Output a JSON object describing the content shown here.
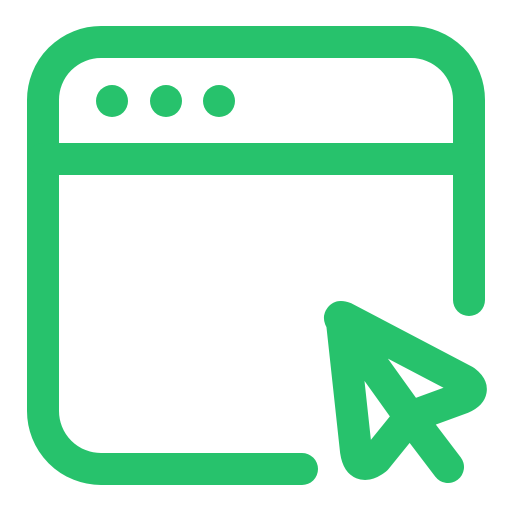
{
  "icon": {
    "name": "browser-window-cursor-icon",
    "color": "#27c26c"
  }
}
